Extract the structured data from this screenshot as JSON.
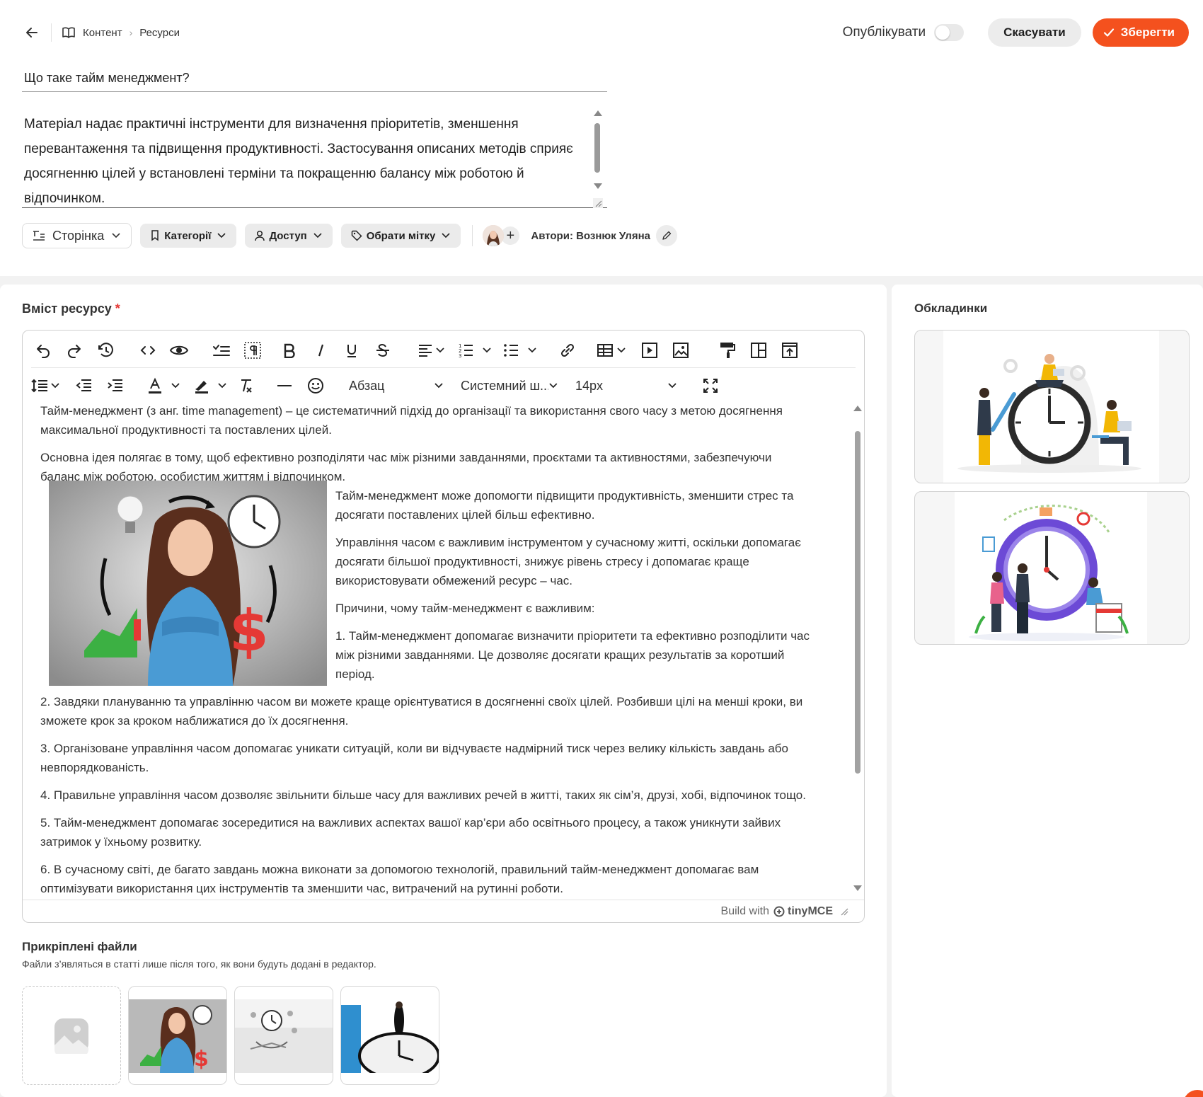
{
  "breadcrumb": {
    "section": "Контент",
    "page": "Ресурси"
  },
  "header": {
    "publish_label": "Опублікувати",
    "publish_enabled": false,
    "cancel_label": "Скасувати",
    "save_label": "Зберегти",
    "accent_color": "#f4511e"
  },
  "resource": {
    "title": "Що таке тайм менеджмент?",
    "description": "Матеріал надає практичні інструменти для визначення пріоритетів, зменшення перевантаження та підвищення продуктивності. Застосування описаних методів сприяє досягненню цілей у встановлені терміни та покращенню балансу між роботою й відпочинком."
  },
  "meta": {
    "type_label": "Сторінка",
    "category_label": "Категорії",
    "access_label": "Доступ",
    "tag_label": "Обрати мітку",
    "authors_text": "Автори: Вознюк Уляна"
  },
  "content_section": {
    "title": "Вміст ресурсу",
    "required_mark": "*"
  },
  "editor": {
    "block_format": "Абзац",
    "font_family": "Системний ш...",
    "font_size": "14px",
    "branding_prefix": "Build with",
    "branding_name": "tinyMCE",
    "paragraphs": [
      "Тайм-менеджмент (з анг. time management) – це систематичний підхід до організації та використання свого часу з метою досягнення максимальної продуктивності та поставлених цілей.",
      "Основна ідея полягає в тому, щоб ефективно розподіляти час між різними завданнями, проєктами та активностями, забезпечуючи баланс між роботою, особистим життям і відпочинком.",
      "Тайм-менеджмент може допомогти підвищити продуктивність, зменшити стрес та досягати поставлених цілей більш ефективно.",
      "Управління часом є важливим інструментом у сучасному житті, оскільки допомагає досягати більшої продуктивності, знижує рівень стресу і допомагає краще використовувати обмежений ресурс – час.",
      "Причини, чому тайм-менеджмент є важливим:",
      "1. Тайм-менеджмент допомагає визначити пріоритети та ефективно розподілити час між різними завданнями. Це дозволяє досягати кращих результатів за коротший період.",
      "2. Завдяки плануванню та управлінню часом ви можете краще орієнтуватися в досягненні своїх цілей. Розбивши цілі на менші кроки, ви зможете крок за кроком наближатися до їх досягнення.",
      "3. Організоване управління часом допомагає уникати ситуацій, коли ви відчуваєте надмірний тиск через велику кількість завдань або невпорядкованість.",
      "4. Правильне управління часом дозволяє звільнити більше часу для важливих речей в житті, таких як сім’я, друзі, хобі, відпочинок тощо.",
      "5. Тайм-менеджмент допомагає зосередитися на важливих аспектах вашої кар’єри або освітнього процесу, а також уникнути зайвих затримок у їхньому розвитку.",
      "6. В сучасному світі, де багато завдань можна виконати за допомогою технологій, правильний тайм-менеджмент допомагає вам оптимізувати використання цих інструментів та зменшити час, витрачений на рутинні роботи."
    ]
  },
  "attachments": {
    "title": "Прикріплені файли",
    "hint": "Файли з’являться в статті лише після того, як вони будуть додані в редактор."
  },
  "covers": {
    "title": "Обкладинки"
  }
}
